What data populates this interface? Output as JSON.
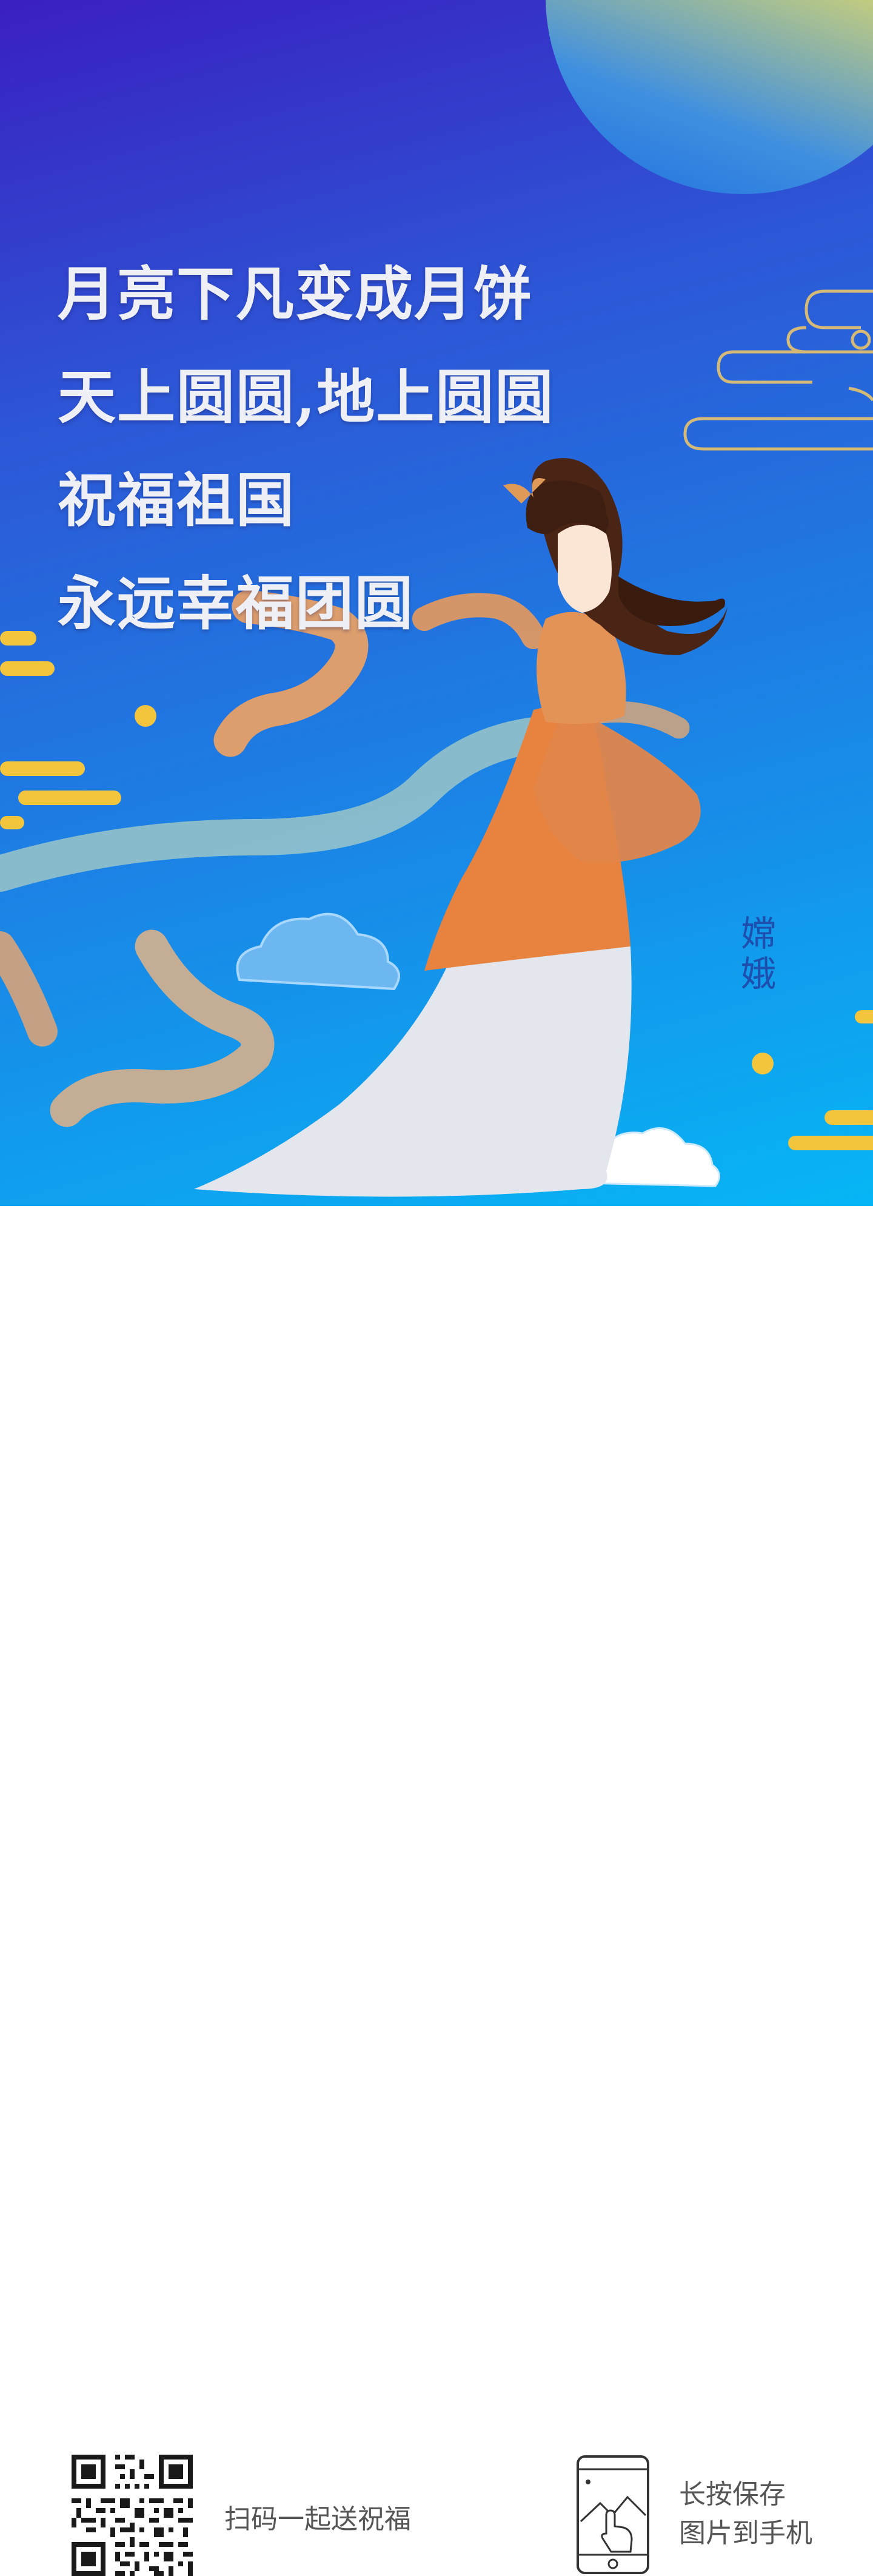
{
  "headline": {
    "line1": "月亮下凡变成月饼",
    "line2": "天上圆圆,地上圆圆",
    "line3": "祝福祖国",
    "line4": "永远幸福团圆"
  },
  "character_label": "嫦娥",
  "footer": {
    "scan_text": "扫码一起送祝福",
    "save_line1": "长按保存",
    "save_line2": "图片到手机"
  },
  "colors": {
    "background_top": "#3a1fc0",
    "background_bottom": "#06b6f5",
    "moon": "#ffe64a",
    "accent_gold": "#f2c53d",
    "robe": "#e8823f",
    "footer_text": "#555555"
  },
  "icons": [
    "moon",
    "qr-code-icon",
    "phone-hand-icon",
    "cloud-decoration"
  ]
}
